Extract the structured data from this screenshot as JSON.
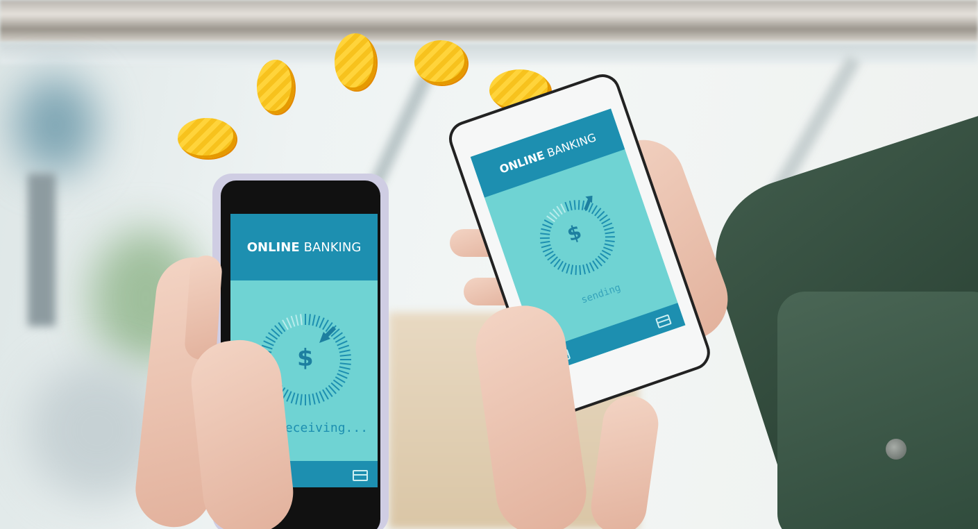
{
  "left_phone": {
    "header_bold": "ONLINE",
    "header_light": "BANKING",
    "currency_symbol": "$",
    "status_text": "receiving...",
    "direction": "incoming"
  },
  "right_phone": {
    "header_bold": "ONLINE",
    "header_light": "BANKING",
    "currency_symbol": "$",
    "status_text": "sending",
    "direction": "outgoing"
  },
  "coins": {
    "count": 5,
    "color": "#ffd43b"
  },
  "colors": {
    "header_blue": "#1d8fb0",
    "screen_teal": "#6fd3d3",
    "jacket_green": "#3f5a4a"
  },
  "icons": [
    "dollar-icon",
    "arrow-in-icon",
    "arrow-out-icon",
    "card-icon",
    "coin-icon"
  ]
}
